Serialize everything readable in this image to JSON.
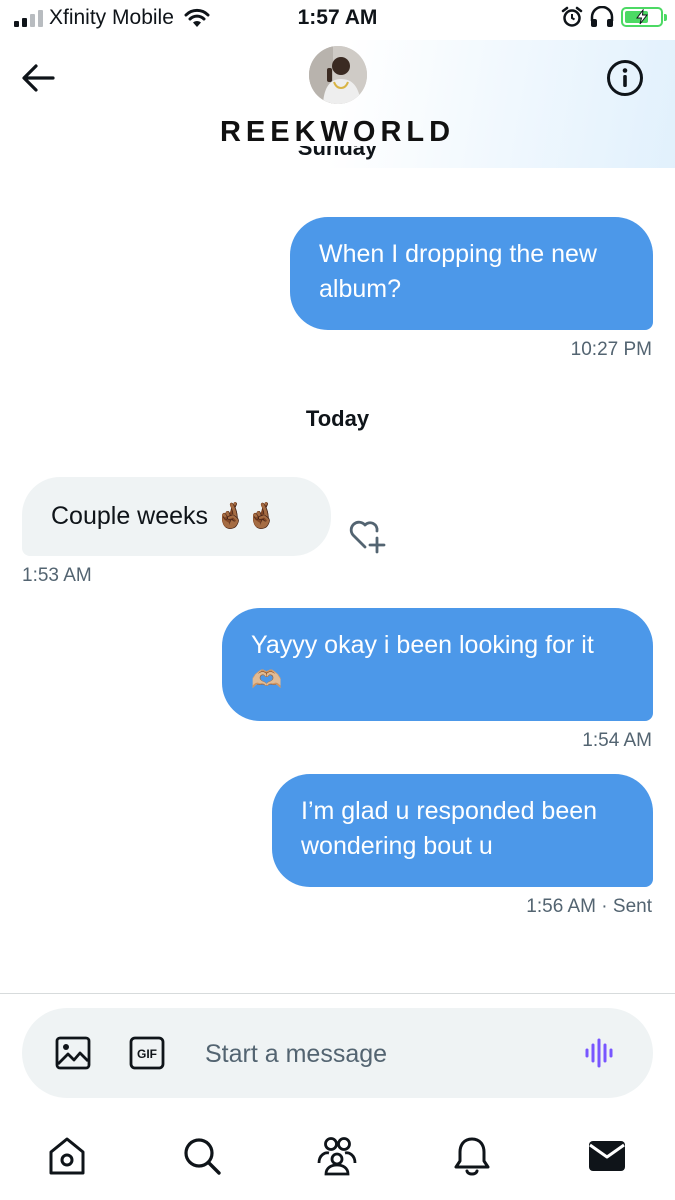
{
  "status_bar": {
    "carrier": "Xfinity Mobile",
    "time": "1:57 AM"
  },
  "header": {
    "contact_name": "REEKWORLD",
    "icons": [
      "back-arrow-icon",
      "info-icon"
    ]
  },
  "messages": {
    "partial_date": "Sunday",
    "m1": {
      "text": "When I dropping the new album?",
      "time": "10:27 PM"
    },
    "today_label": "Today",
    "m2": {
      "text": "Couple weeks 🤞🏾🤞🏾",
      "time": "1:53 AM"
    },
    "m3": {
      "text": "Yayyy okay i been looking for it 🫶🏼",
      "time": "1:54 AM"
    },
    "m4": {
      "text": "I’m glad u responded been wondering bout u",
      "time": "1:56 AM",
      "status": "· Sent"
    }
  },
  "composer": {
    "placeholder": "Start a message",
    "gif_label": "GIF",
    "icons": [
      "image-icon",
      "gif-icon",
      "voice-icon"
    ]
  },
  "tabs": [
    "home-icon",
    "search-icon",
    "communities-icon",
    "notifications-icon",
    "messages-icon"
  ],
  "colors": {
    "outgoing_bubble": "#4c98e9",
    "incoming_bubble": "#eff3f4",
    "timestamp": "#536471",
    "voice_accent": "#7856ff",
    "battery": "#4cd964"
  }
}
